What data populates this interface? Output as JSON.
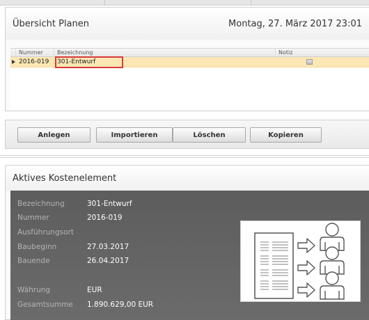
{
  "overview": {
    "title": "Übersicht Planen",
    "datetime": "Montag, 27. März 2017 23:01"
  },
  "grid": {
    "columns": [
      "Nummer",
      "Bezeichnung",
      "Notiz"
    ],
    "rows": [
      {
        "nummer": "2016-019",
        "bezeichnung": "301-Entwurf",
        "notiz": ""
      }
    ]
  },
  "buttons": {
    "anlegen": "Anlegen",
    "importieren": "Importieren",
    "loeschen": "Löschen",
    "kopieren": "Kopieren"
  },
  "active": {
    "title": "Aktives Kostenelement",
    "fields": [
      {
        "label": "Bezeichnung",
        "value": "301-Entwurf"
      },
      {
        "label": "Nummer",
        "value": "2016-019"
      },
      {
        "label": "Ausführungsort",
        "value": ""
      },
      {
        "label": "Baubeginn",
        "value": "27.03.2017"
      },
      {
        "label": "Bauende",
        "value": "26.04.2017"
      },
      {
        "label": "Währung",
        "value": "EUR"
      },
      {
        "label": "Gesamtsumme",
        "value": "1.890.629,00 EUR"
      }
    ]
  },
  "colors": {
    "selected_row": "#fbe7b3",
    "highlight": "#d93a3a",
    "dark_panel": "#636363"
  },
  "icons": [
    "row-indicator-icon",
    "note-icon",
    "document-to-persons-illustration"
  ]
}
